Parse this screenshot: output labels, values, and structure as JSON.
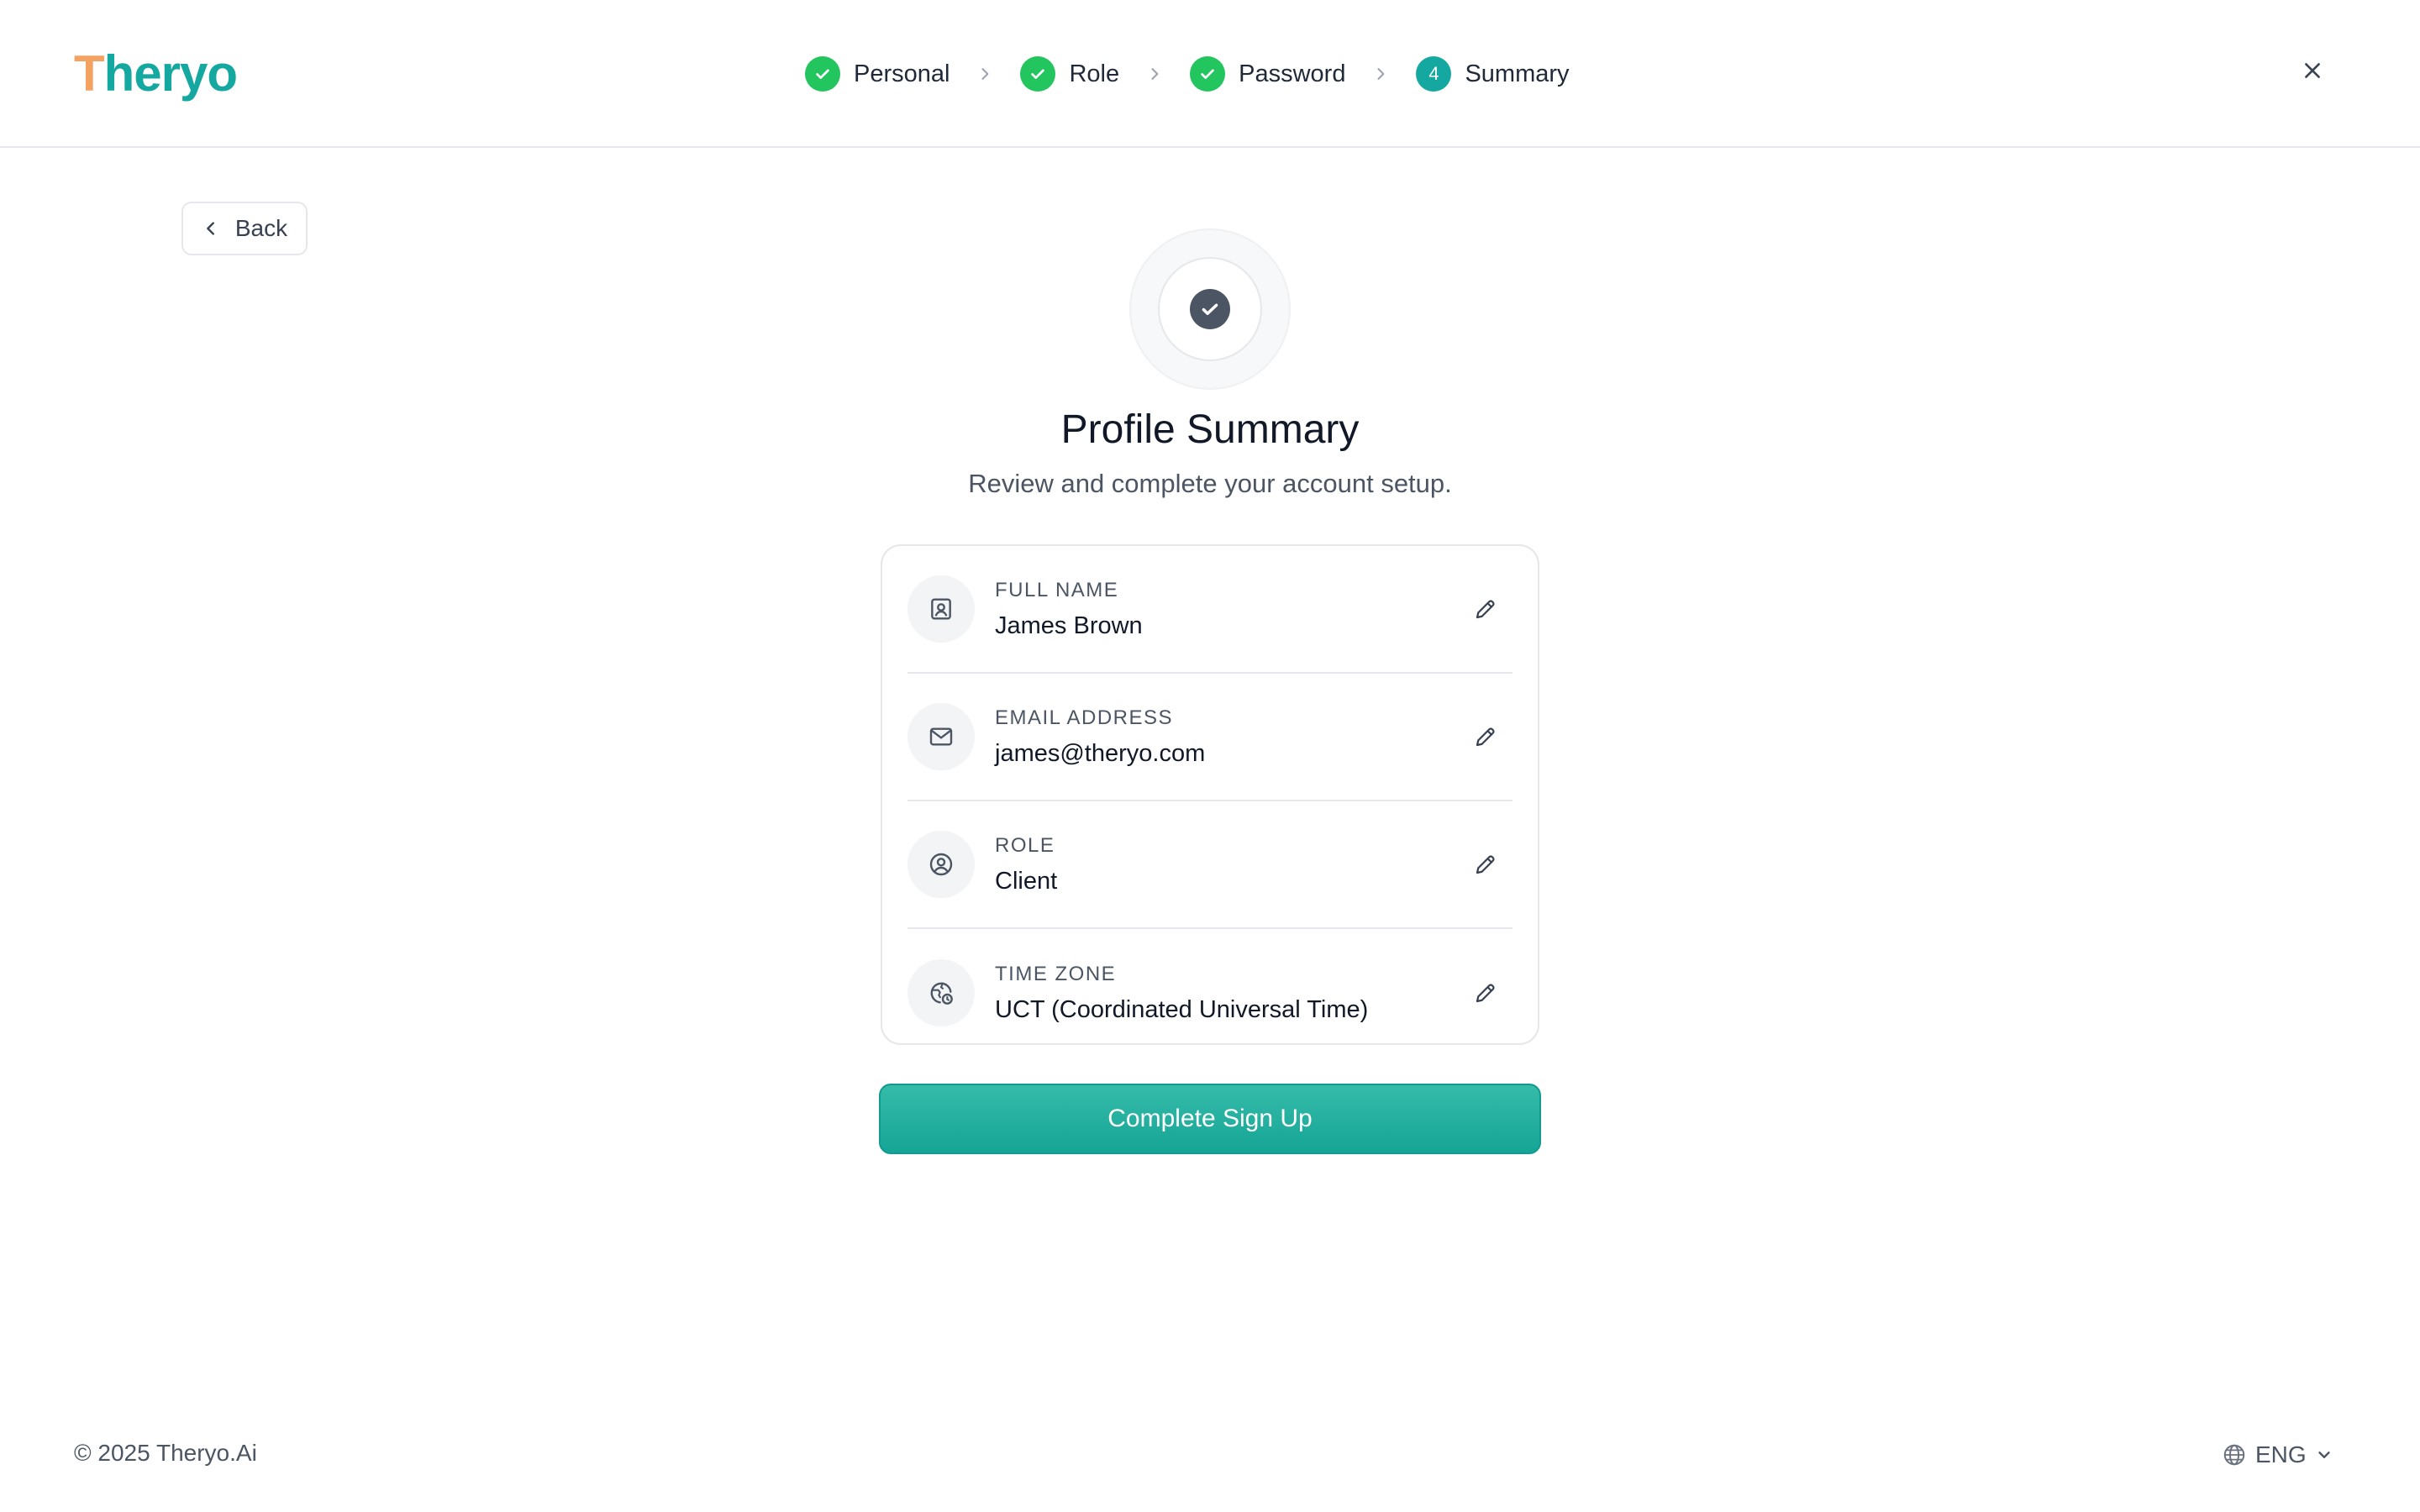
{
  "brand": {
    "logo_first": "T",
    "logo_rest": "heryo"
  },
  "stepper": {
    "steps": [
      {
        "label": "Personal",
        "status": "done",
        "marker": ""
      },
      {
        "label": "Role",
        "status": "done",
        "marker": ""
      },
      {
        "label": "Password",
        "status": "done",
        "marker": ""
      },
      {
        "label": "Summary",
        "status": "current",
        "marker": "4"
      }
    ]
  },
  "nav": {
    "back_label": "Back"
  },
  "hero": {
    "title": "Profile Summary",
    "subtitle": "Review and complete your account setup."
  },
  "summary": {
    "rows": [
      {
        "label": "FULL NAME",
        "value": "James Brown",
        "icon": "id-badge-icon"
      },
      {
        "label": "EMAIL ADDRESS",
        "value": "james@theryo.com",
        "icon": "mail-icon"
      },
      {
        "label": "ROLE",
        "value": "Client",
        "icon": "user-circle-icon"
      },
      {
        "label": "TIME ZONE",
        "value": "UCT (Coordinated Universal Time)",
        "icon": "globe-clock-icon"
      }
    ]
  },
  "cta": {
    "label": "Complete Sign Up"
  },
  "footer": {
    "copyright": "© 2025 Theryo.Ai",
    "language": "ENG"
  },
  "colors": {
    "brand": "#14a8a0",
    "accent": "#f4a261",
    "success": "#22c55e",
    "cta": "#1fab9c"
  }
}
